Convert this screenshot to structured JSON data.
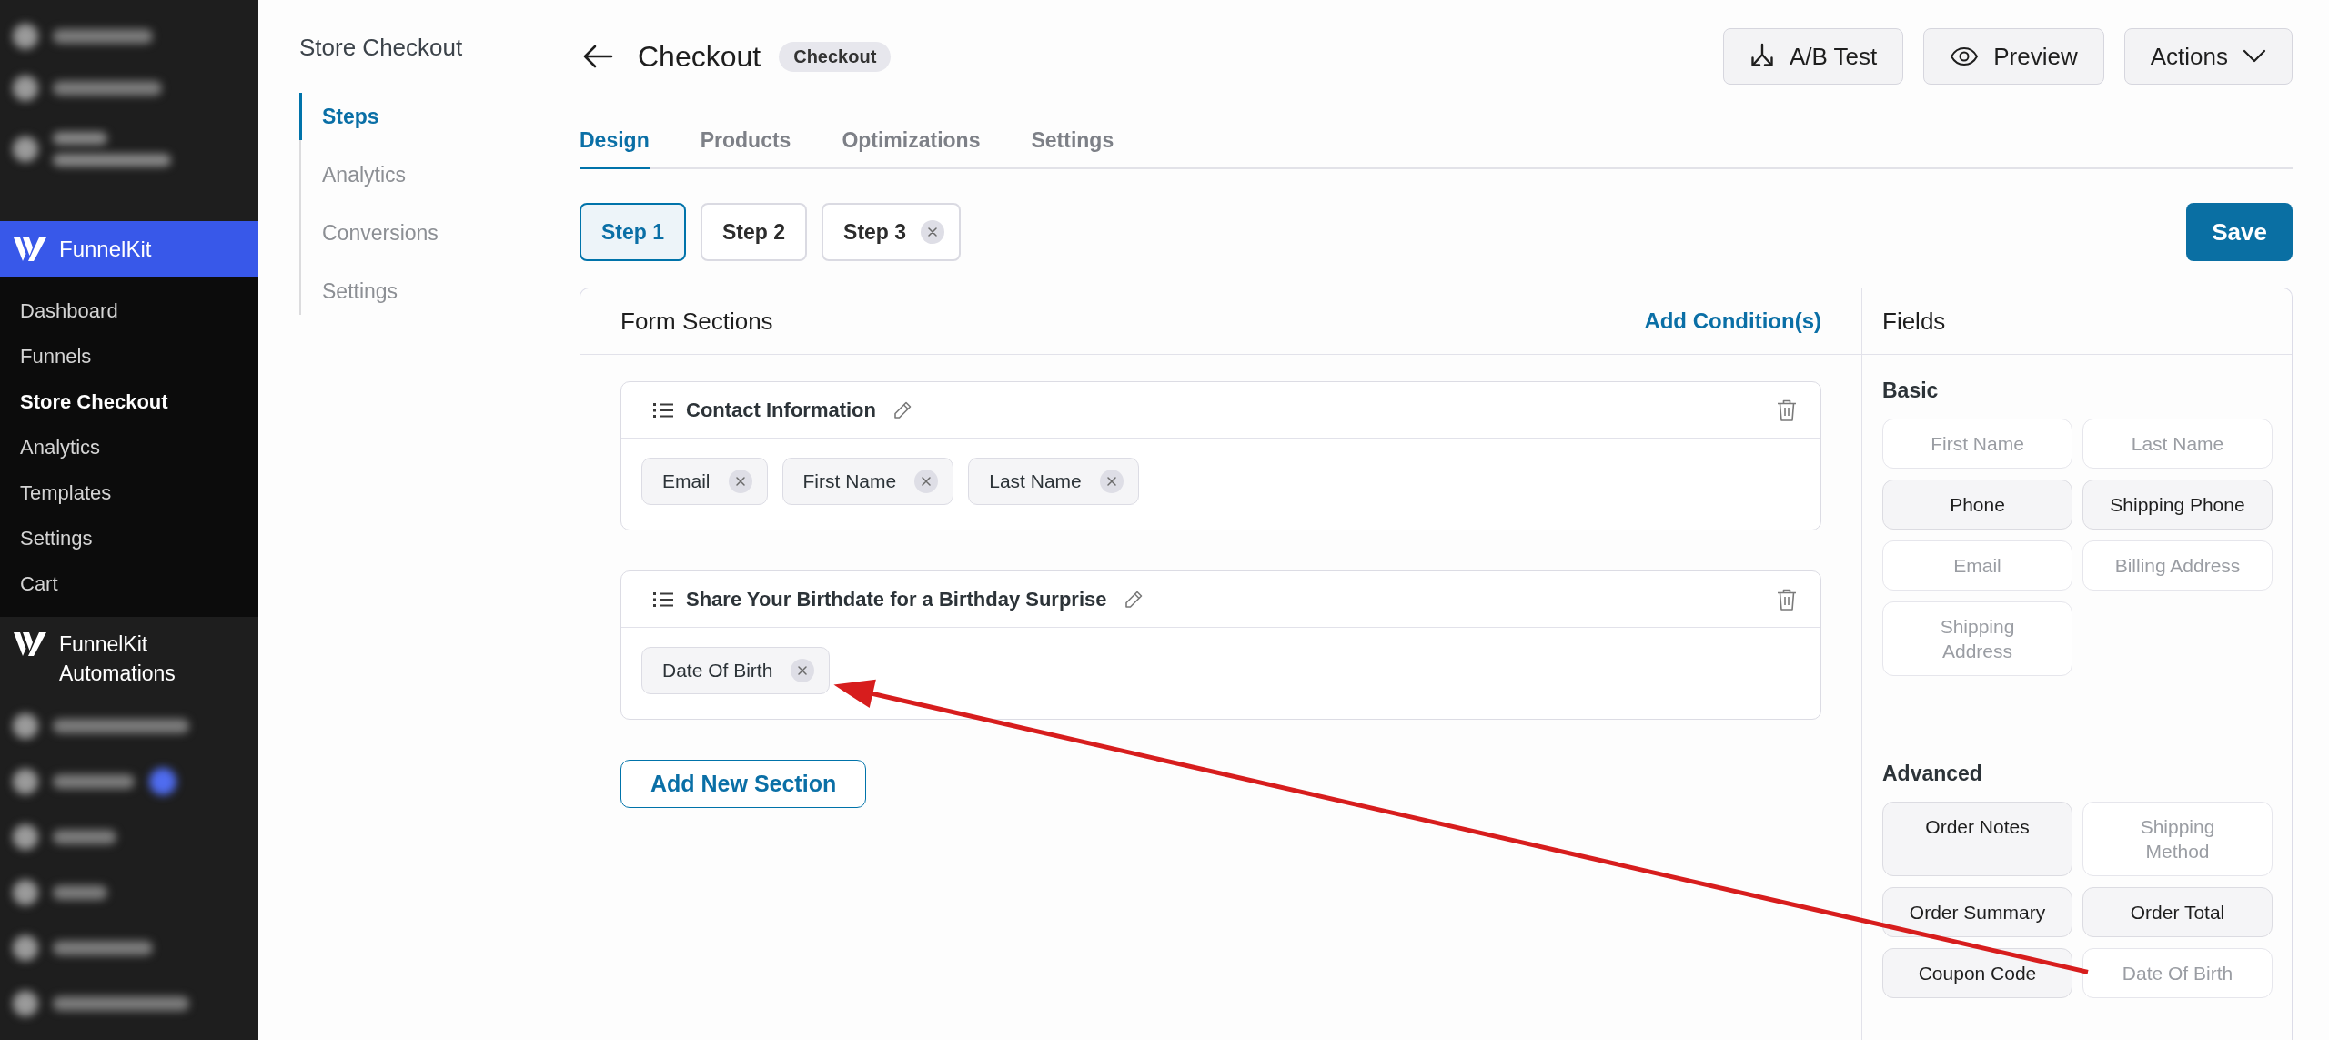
{
  "admin_menu": {
    "brand": "FunnelKit",
    "items": [
      {
        "label": "Dashboard",
        "selected": false
      },
      {
        "label": "Funnels",
        "selected": false
      },
      {
        "label": "Store Checkout",
        "selected": true
      },
      {
        "label": "Analytics",
        "selected": false
      },
      {
        "label": "Templates",
        "selected": false
      },
      {
        "label": "Settings",
        "selected": false
      },
      {
        "label": "Cart",
        "selected": false
      }
    ],
    "secondary_brand": "FunnelKit Automations"
  },
  "sub_nav": {
    "title": "Store Checkout",
    "items": [
      {
        "label": "Steps",
        "selected": true
      },
      {
        "label": "Analytics",
        "selected": false
      },
      {
        "label": "Conversions",
        "selected": false
      },
      {
        "label": "Settings",
        "selected": false
      }
    ]
  },
  "header": {
    "title": "Checkout",
    "badge": "Checkout",
    "buttons": [
      {
        "label": "A/B Test",
        "kind": "split"
      },
      {
        "label": "Preview",
        "kind": "preview"
      },
      {
        "label": "Actions",
        "kind": "dropdown"
      }
    ]
  },
  "tabs": [
    {
      "label": "Design",
      "selected": true
    },
    {
      "label": "Products",
      "selected": false
    },
    {
      "label": "Optimizations",
      "selected": false
    },
    {
      "label": "Settings",
      "selected": false
    }
  ],
  "steps": [
    {
      "label": "Step 1",
      "selected": true,
      "removable": false
    },
    {
      "label": "Step 2",
      "selected": false,
      "removable": false
    },
    {
      "label": "Step 3",
      "selected": false,
      "removable": true
    }
  ],
  "save_button": {
    "label": "Save"
  },
  "form_sections": {
    "title": "Form Sections",
    "add_condition": "Add Condition(s)",
    "sections": [
      {
        "title": "Contact Information",
        "fields": [
          "Email",
          "First Name",
          "Last Name"
        ]
      },
      {
        "title": "Share Your Birthdate for a Birthday Surprise",
        "fields": [
          "Date Of Birth"
        ]
      }
    ],
    "add_section": "Add New Section"
  },
  "fields_panel": {
    "title": "Fields",
    "groups": [
      {
        "title": "Basic",
        "items": [
          {
            "label": "First Name",
            "disabled": true
          },
          {
            "label": "Last Name",
            "disabled": true
          },
          {
            "label": "Phone",
            "disabled": false
          },
          {
            "label": "Shipping Phone",
            "disabled": false
          },
          {
            "label": "Email",
            "disabled": true
          },
          {
            "label": "Billing Address",
            "disabled": true
          },
          {
            "label": "Shipping Address",
            "disabled": true
          }
        ]
      },
      {
        "title": "Advanced",
        "items": [
          {
            "label": "Order Notes",
            "disabled": false
          },
          {
            "label": "Shipping Method",
            "disabled": true
          },
          {
            "label": "Order Summary",
            "disabled": false
          },
          {
            "label": "Order Total",
            "disabled": false
          },
          {
            "label": "Coupon Code",
            "disabled": false
          },
          {
            "label": "Date Of Birth",
            "disabled": true
          }
        ]
      }
    ]
  },
  "annotations": [
    {
      "kind": "arrow"
    }
  ]
}
